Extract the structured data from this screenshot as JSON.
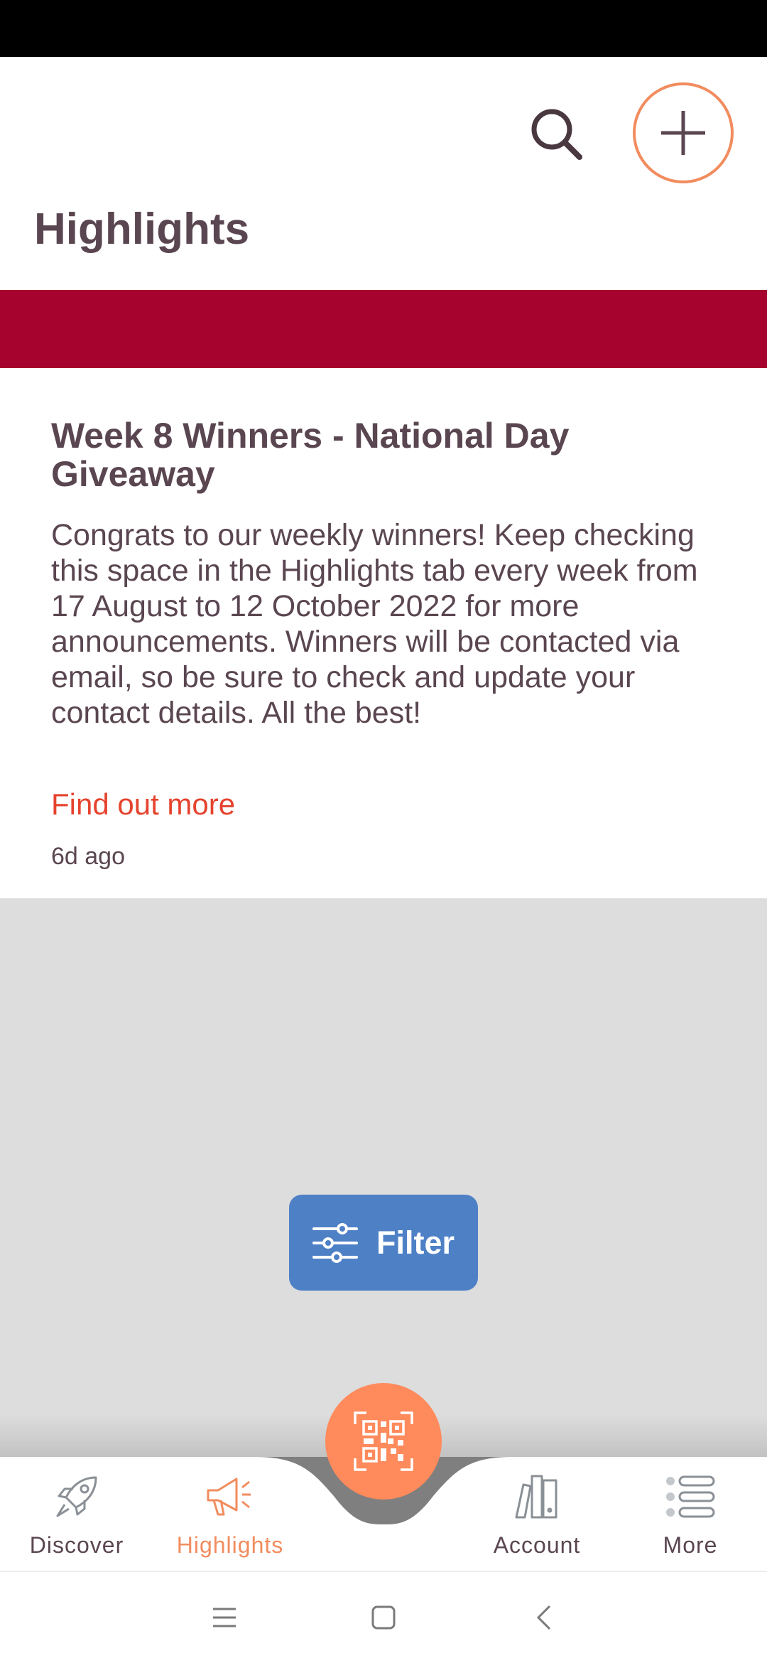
{
  "header": {
    "title": "Highlights",
    "search_icon": "search-icon",
    "add_icon": "plus-icon",
    "accent_color": "#f28c5e"
  },
  "banner": {
    "color": "#a6042f"
  },
  "card": {
    "title": "Week 8 Winners - National Day Giveaway",
    "body": "Congrats to our weekly winners! Keep checking this space in the Highlights tab every week from 17 August to 12 October 2022 for more announcements. Winners will be contacted via email, so be sure to check and update your contact details. All the best!",
    "link": "Find out more",
    "time": "6d ago"
  },
  "filter": {
    "label": "Filter",
    "icon": "sliders-icon",
    "color": "#4e80c6"
  },
  "bottom_nav": {
    "items": [
      {
        "label": "Discover",
        "icon": "rocket-icon",
        "active": false
      },
      {
        "label": "Highlights",
        "icon": "megaphone-icon",
        "active": true
      },
      {
        "label": "Account",
        "icon": "books-icon",
        "active": false
      },
      {
        "label": "More",
        "icon": "list-icon",
        "active": false
      }
    ],
    "center_button_icon": "qr-code-icon",
    "center_button_color": "#ff8a5c"
  },
  "system_nav": {
    "icons": [
      "menu-icon",
      "home-icon",
      "back-icon"
    ]
  }
}
